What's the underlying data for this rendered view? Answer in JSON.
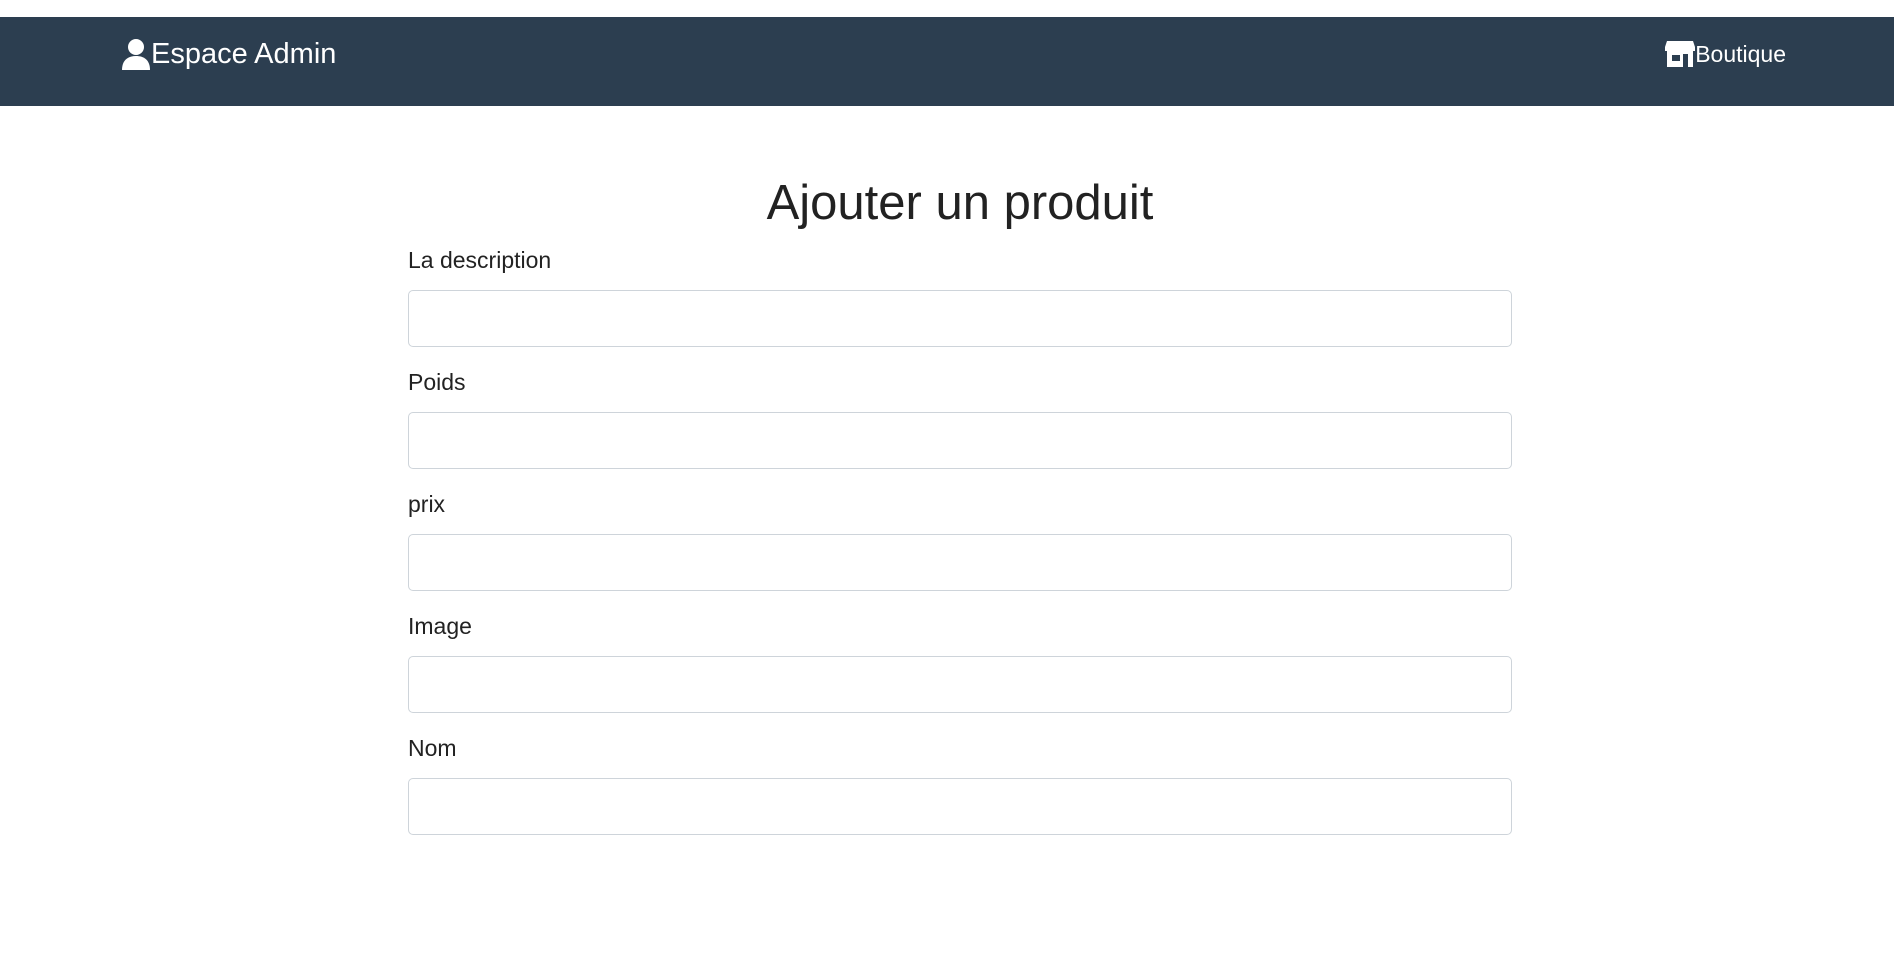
{
  "navbar": {
    "brand_label": "Espace Admin",
    "brand_icon": "user-icon",
    "shop_label": "Boutique",
    "shop_icon": "store-icon",
    "background": "#2c3e50"
  },
  "page": {
    "title": "Ajouter un produit"
  },
  "form": {
    "fields": [
      {
        "label": "La description",
        "value": "",
        "placeholder": ""
      },
      {
        "label": "Poids",
        "value": "",
        "placeholder": ""
      },
      {
        "label": "prix",
        "value": "",
        "placeholder": ""
      },
      {
        "label": "Image",
        "value": "",
        "placeholder": ""
      },
      {
        "label": "Nom",
        "value": "",
        "placeholder": ""
      }
    ]
  }
}
